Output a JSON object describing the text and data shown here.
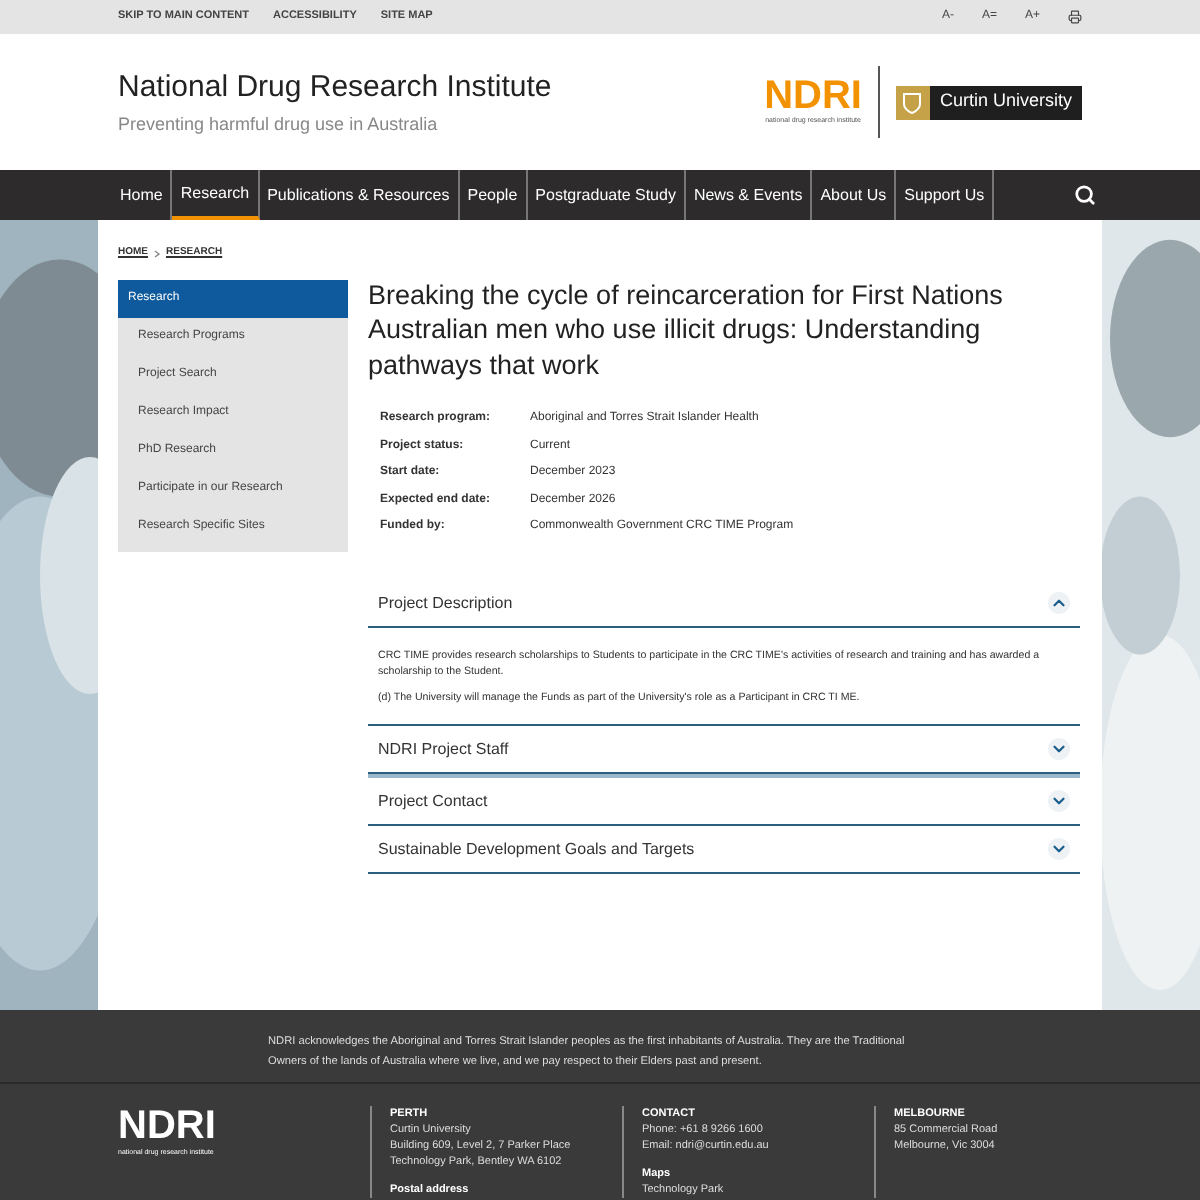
{
  "utility_bar": {
    "links": [
      "SKIP TO MAIN CONTENT",
      "ACCESSIBILITY",
      "SITE MAP"
    ],
    "font_sizes": [
      "A-",
      "A=",
      "A+"
    ]
  },
  "header": {
    "title": "National Drug Research Institute",
    "tagline": "Preventing harmful drug use in Australia",
    "logo": {
      "text": "NDRI",
      "subtext": "national drug research institute"
    },
    "partner": "Curtin University"
  },
  "nav": {
    "items": [
      {
        "label": "Home",
        "selected": false
      },
      {
        "label": "Research",
        "selected": true
      },
      {
        "label": "Publications & Resources",
        "selected": false
      },
      {
        "label": "People",
        "selected": false
      },
      {
        "label": "Postgraduate Study",
        "selected": false
      },
      {
        "label": "News & Events",
        "selected": false
      },
      {
        "label": "About Us",
        "selected": false
      },
      {
        "label": "Support Us",
        "selected": false
      }
    ]
  },
  "breadcrumb": [
    "HOME",
    "RESEARCH"
  ],
  "sidebar": {
    "items": [
      {
        "label": "Research",
        "selected": true
      },
      {
        "label": "Research Programs",
        "selected": false
      },
      {
        "label": "Project Search",
        "selected": false
      },
      {
        "label": "Research Impact",
        "selected": false
      },
      {
        "label": "PhD Research",
        "selected": false
      },
      {
        "label": "Participate in our Research",
        "selected": false
      },
      {
        "label": "Research Specific Sites",
        "selected": false
      }
    ]
  },
  "page_title": "Breaking the cycle of reincarceration for First Nations Australian men who use illicit drugs: Understanding pathways that work",
  "details": [
    {
      "label": "Research program:",
      "value": "Aboriginal and Torres Strait Islander Health"
    },
    {
      "label": "Project status:",
      "value": "Current"
    },
    {
      "label": "Start date:",
      "value": "December 2023"
    },
    {
      "label": "Expected end date:",
      "value": "December 2026"
    },
    {
      "label": "Funded by:",
      "value": "Commonwealth Government CRC TIME Program"
    }
  ],
  "accordion": [
    {
      "title": "Project Description",
      "expanded": true,
      "body": [
        "CRC TIME provides research scholarships to Students to participate in the CRC TIME's activities of research and training and has awarded a scholarship to the Student.",
        "(d) The University will manage the Funds as part of the University's role as a Participant in CRC TI ME."
      ]
    },
    {
      "title": "NDRI Project Staff",
      "expanded": false
    },
    {
      "title": "Project Contact",
      "expanded": false
    },
    {
      "title": "Sustainable Development Goals and Targets",
      "expanded": false
    }
  ],
  "footer": {
    "acknowledgement": "NDRI acknowledges the Aboriginal and Torres Strait Islander peoples as the first inhabitants of Australia. They are the Traditional Owners of the lands of Australia where we live, and we pay respect to their Elders past and present.",
    "logo": {
      "text": "NDRI",
      "subtext": "national drug research institute"
    },
    "columns": [
      {
        "heading": "PERTH",
        "lines": [
          "Curtin University",
          "Building 609, Level 2, 7 Parker Place",
          "Technology Park, Bentley WA 6102"
        ],
        "subheading": "Postal address"
      },
      {
        "heading": "CONTACT",
        "lines": [
          "Phone: +61 8 9266 1600",
          "Email: ndri@curtin.edu.au"
        ],
        "subheading": "Maps",
        "sublines": [
          "Technology Park"
        ]
      },
      {
        "heading": "MELBOURNE",
        "lines": [
          "85 Commercial Road",
          "Melbourne, Vic 3004"
        ]
      }
    ]
  }
}
